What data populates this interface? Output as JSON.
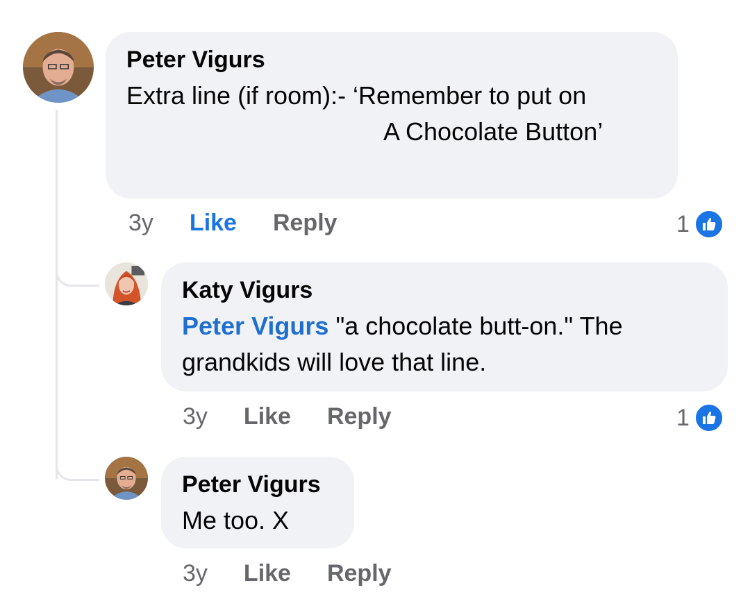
{
  "comments": [
    {
      "author": "Peter Vigurs",
      "text_line1": "Extra line (if room):- ‘Remember to put on",
      "text_line2": "A Chocolate Button’",
      "time": "3y",
      "like_label": "Like",
      "reply_label": "Reply",
      "reaction_count": "1",
      "reaction_icon": "thumbs-up-icon",
      "liked": true
    },
    {
      "author": "Katy Vigurs",
      "mention": "Peter Vigurs",
      "text_after_mention": " \"a chocolate butt-on.\" The",
      "text_line2": "grandkids will love that line.",
      "time": "3y",
      "like_label": "Like",
      "reply_label": "Reply",
      "reaction_count": "1",
      "reaction_icon": "thumbs-up-icon"
    },
    {
      "author": "Peter Vigurs",
      "text": "Me too. X",
      "time": "3y",
      "like_label": "Like",
      "reply_label": "Reply"
    }
  ],
  "colors": {
    "bubble": "#f0f2f5",
    "mention": "#1f6fd0",
    "like_active": "#1b74e4",
    "meta_text": "#65676b"
  }
}
